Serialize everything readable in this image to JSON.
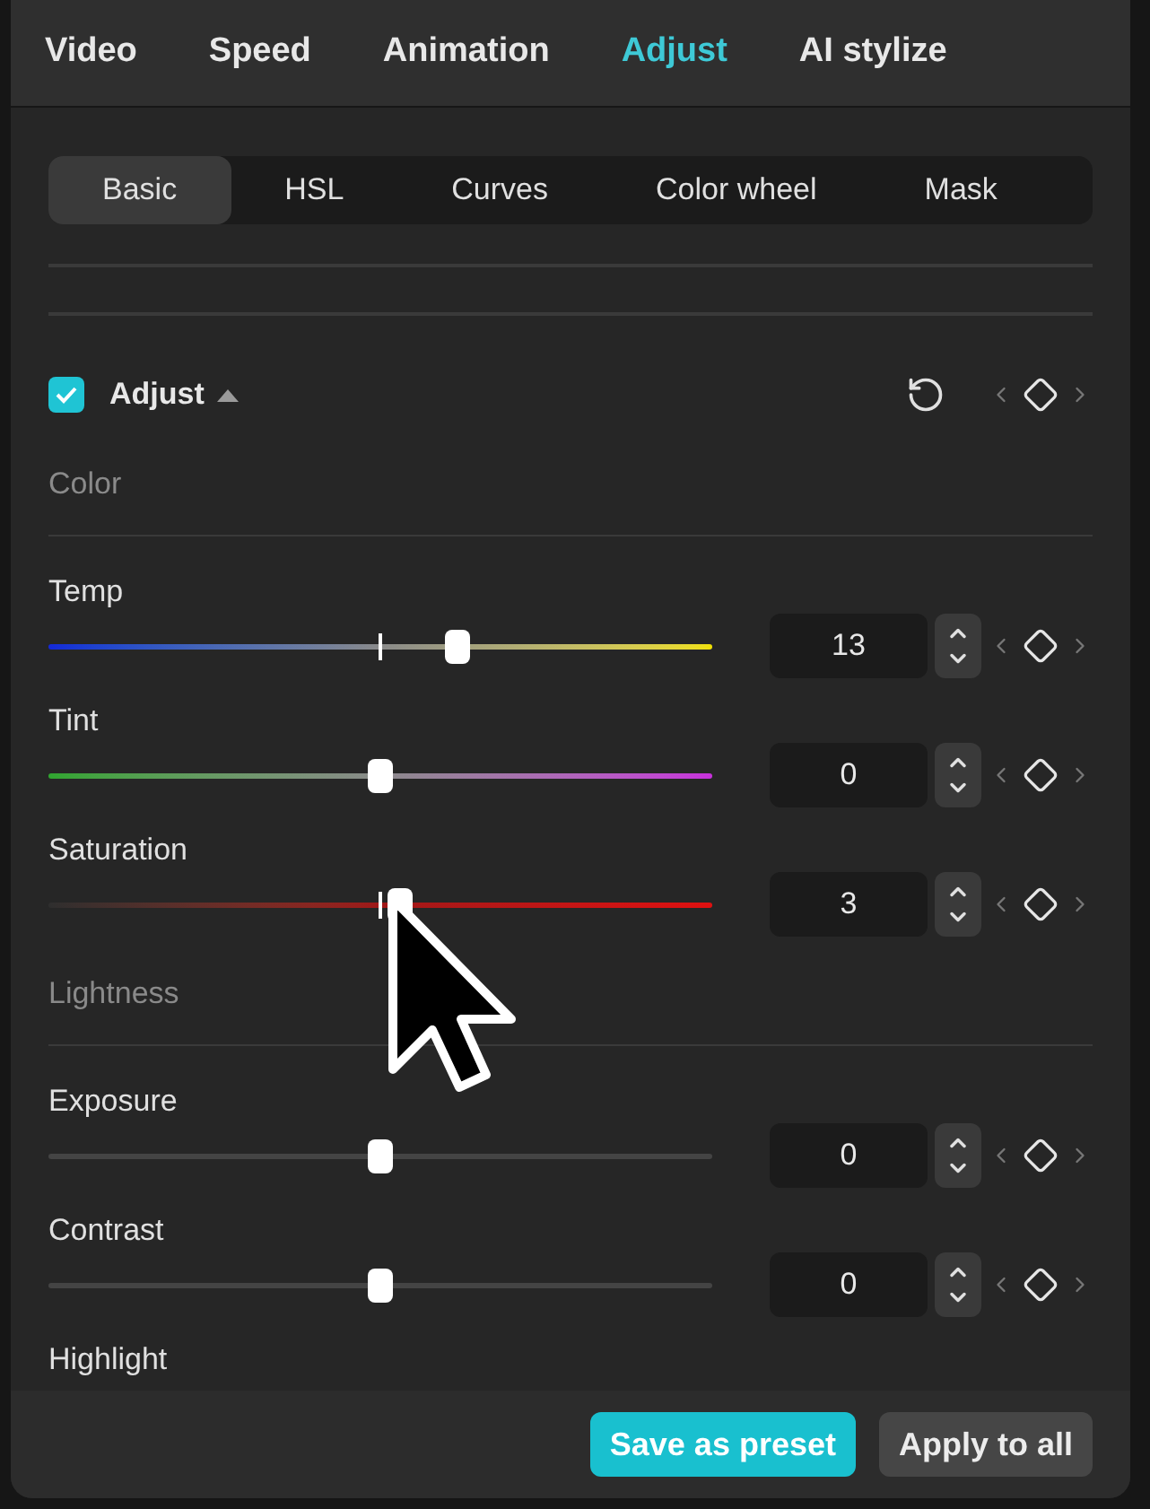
{
  "tabs": [
    {
      "label": "Video",
      "selected": false
    },
    {
      "label": "Speed",
      "selected": false
    },
    {
      "label": "Animation",
      "selected": false
    },
    {
      "label": "Adjust",
      "selected": true
    },
    {
      "label": "AI stylize",
      "selected": false
    }
  ],
  "subtabs": [
    {
      "label": "Basic",
      "selected": true
    },
    {
      "label": "HSL",
      "selected": false
    },
    {
      "label": "Curves",
      "selected": false
    },
    {
      "label": "Color wheel",
      "selected": false
    },
    {
      "label": "Mask",
      "selected": false
    }
  ],
  "section": {
    "title": "Adjust",
    "checked": true,
    "expanded": true
  },
  "groups": [
    {
      "label": "Color",
      "sliders": [
        {
          "label": "Temp",
          "kind": "temp",
          "level": 0.62,
          "value": "13"
        },
        {
          "label": "Tint",
          "kind": "tint",
          "level": 0.5,
          "value": "0"
        },
        {
          "label": "Saturation",
          "kind": "saturation",
          "level": 0.53,
          "value": "3"
        }
      ]
    },
    {
      "label": "Lightness",
      "sliders": [
        {
          "label": "Exposure",
          "kind": "neutral",
          "level": 0.5,
          "value": "0"
        },
        {
          "label": "Contrast",
          "kind": "neutral",
          "level": 0.5,
          "value": "0"
        }
      ]
    }
  ],
  "next_label": "Highlight",
  "buttons": [
    {
      "label": "Save as preset",
      "kind": "primary"
    },
    {
      "label": "Apply to all",
      "kind": "secondary"
    }
  ]
}
